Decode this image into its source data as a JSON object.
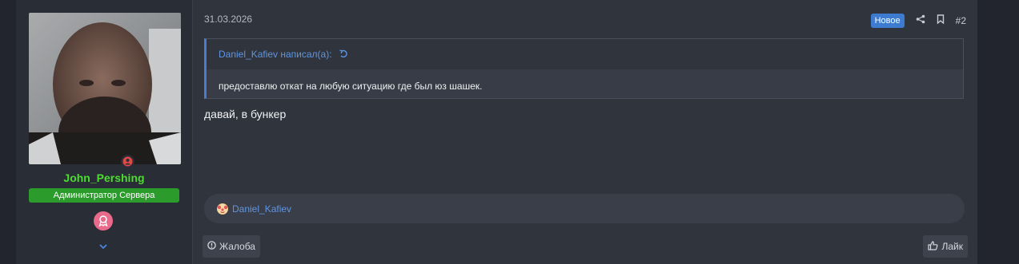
{
  "post": {
    "date": "31.03.2026",
    "new_badge": "Новое",
    "post_number": "#2",
    "message": "давай, в бункер"
  },
  "user": {
    "name": "John_Pershing",
    "name_color": "#4ddb32",
    "role": "Администратор Сервера",
    "role_color": "#2b9b2b"
  },
  "quote": {
    "author_line": "Daniel_Kafiev написал(а):",
    "text": "предоставлю откат на любую ситуацию где был юз шашек."
  },
  "reactions": {
    "users": "Daniel_Kafiev"
  },
  "actions": {
    "report": "Жалоба",
    "like": "Лайк"
  },
  "icons": {
    "share": "share-icon",
    "bookmark": "bookmark-icon",
    "quote_jump": "arrow-up-icon",
    "report": "alert-circle-icon",
    "like": "thumbs-up-icon",
    "award": "award-icon",
    "online": "online-status-icon",
    "expand": "chevron-down-icon"
  }
}
